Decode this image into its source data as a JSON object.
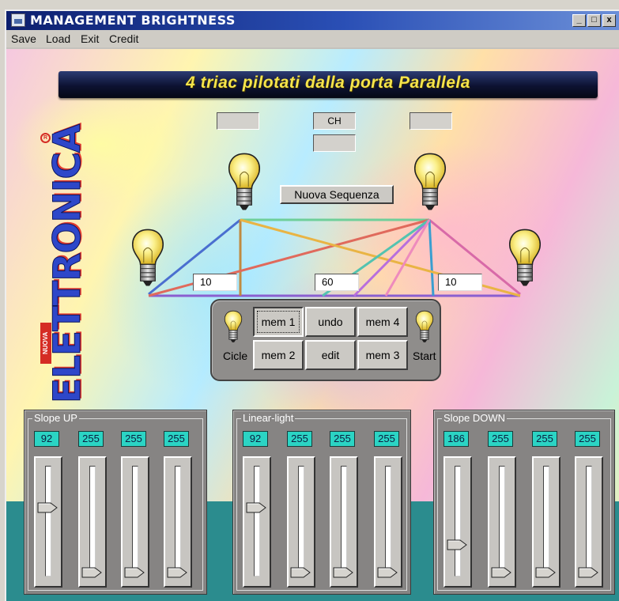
{
  "window": {
    "title": "MANAGEMENT BRIGHTNESS",
    "controls": [
      "_",
      "□",
      "x"
    ]
  },
  "menu": [
    "Save",
    "Load",
    "Exit",
    "Credit"
  ],
  "banner": "4 triac pilotati dalla porta Parallela",
  "logo": {
    "brand": "ELETTRONICA",
    "sub": "NUOVA",
    "reg": "R"
  },
  "channel": {
    "label": "CH",
    "left_box": "",
    "right_box": "",
    "below_box": ""
  },
  "new_sequence_button": "Nuova Sequenza",
  "timings": {
    "left": "10",
    "center": "60",
    "right": "10"
  },
  "memory_panel": {
    "cicle_label": "Cicle",
    "start_label": "Start",
    "buttons": [
      {
        "label": "mem 1",
        "focused": true
      },
      {
        "label": "undo"
      },
      {
        "label": "mem 4"
      },
      {
        "label": "mem 2"
      },
      {
        "label": "edit"
      },
      {
        "label": "mem 3"
      }
    ]
  },
  "slider_groups": [
    {
      "title": "Slope UP",
      "values": [
        "92",
        "255",
        "255",
        "255"
      ],
      "levels": [
        92,
        255,
        255,
        255
      ]
    },
    {
      "title": "Linear-light",
      "values": [
        "92",
        "255",
        "255",
        "255"
      ],
      "levels": [
        92,
        255,
        255,
        255
      ]
    },
    {
      "title": "Slope DOWN",
      "values": [
        "186",
        "255",
        "255",
        "255"
      ],
      "levels": [
        186,
        255,
        255,
        255
      ]
    }
  ],
  "slider_max": 255,
  "icons": {
    "bulb": "light-bulb-icon",
    "app": "app-icon"
  }
}
